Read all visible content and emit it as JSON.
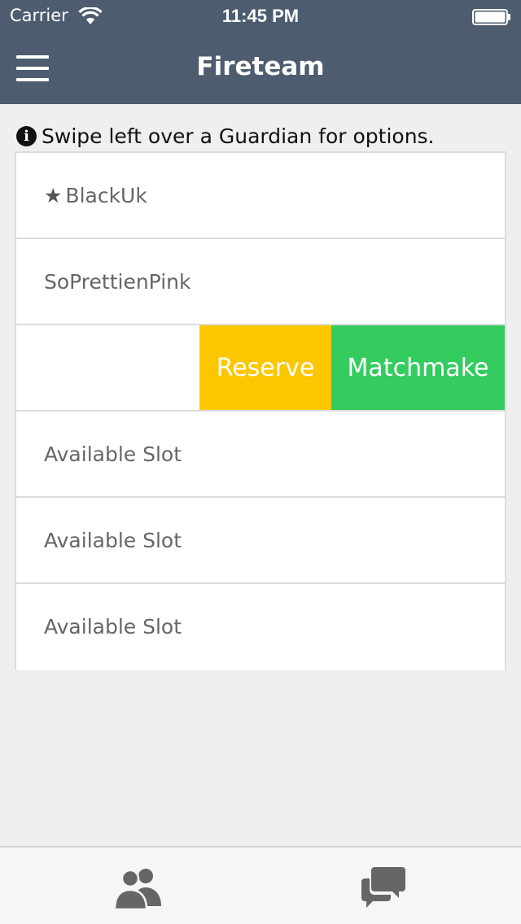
{
  "status_bar": {
    "carrier": "Carrier",
    "time": "11:45 PM"
  },
  "nav": {
    "title": "Fireteam",
    "menu_icon": "hamburger-menu-icon",
    "bar_color": "#4d5d6f"
  },
  "hint": {
    "icon": "info-icon",
    "icon_glyph": "i",
    "text": "Swipe left over a Guardian for options."
  },
  "fireteam": {
    "members": [
      {
        "star": "★",
        "name": "BlackUk"
      },
      {
        "name": "SoPrettienPink"
      },
      {
        "name": ""
      },
      {
        "name": "Available Slot"
      },
      {
        "name": "Available Slot"
      },
      {
        "name": "Available Slot"
      }
    ],
    "swipe_actions": {
      "reserve": {
        "label": "Reserve",
        "color": "#fdc700"
      },
      "matchmake": {
        "label": "Matchmake",
        "color": "#34cc5f"
      }
    }
  },
  "tab_bar": {
    "tabs": [
      {
        "icon": "group-icon"
      },
      {
        "icon": "chat-bubbles-icon"
      }
    ]
  }
}
